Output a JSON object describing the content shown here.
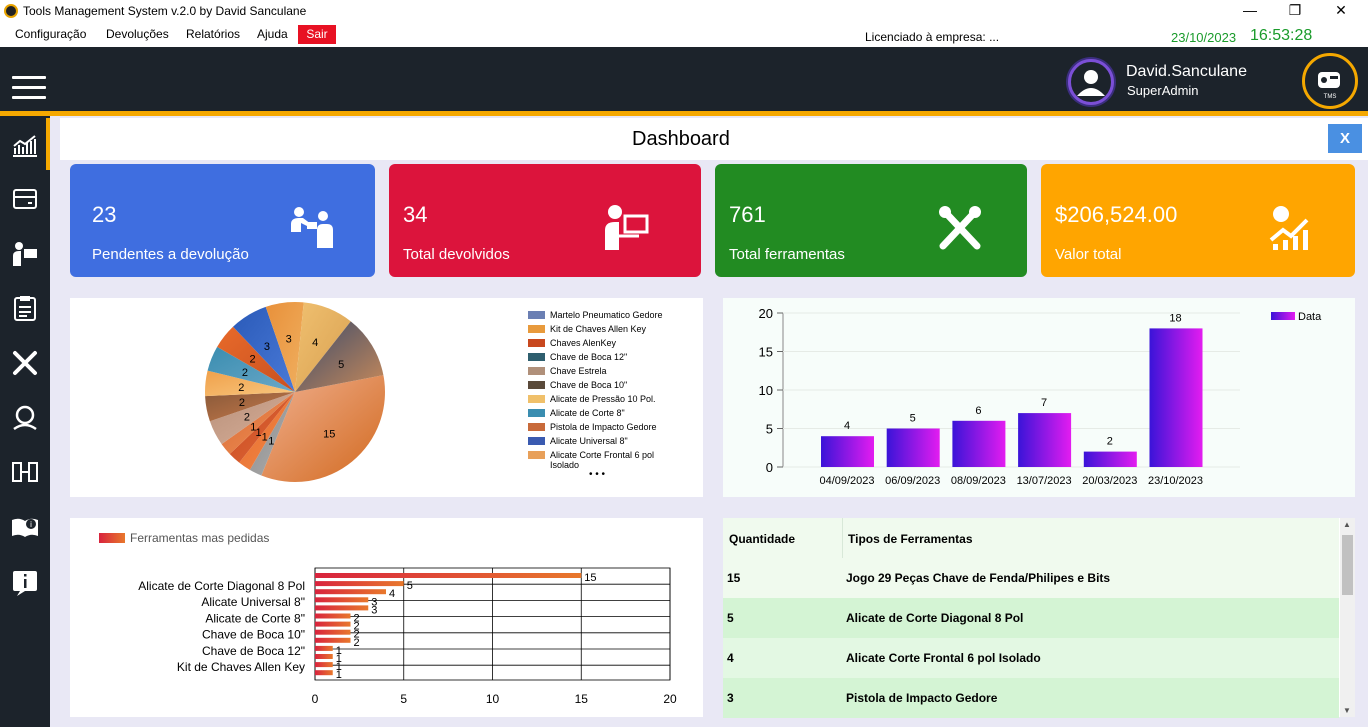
{
  "window": {
    "title": "Tools Management System v.2.0 by David Sanculane"
  },
  "menu": {
    "items": [
      "Configuração",
      "Devoluções",
      "Relatórios",
      "Ajuda"
    ],
    "exit": "Sair"
  },
  "status": {
    "license": "Licenciado à empresa: ...",
    "date": "23/10/2023",
    "time": "16:53:28"
  },
  "user": {
    "name": "David.Sanculane",
    "role": "SuperAdmin",
    "logo_text": "TMS"
  },
  "dashboard": {
    "title": "Dashboard",
    "close": "X"
  },
  "cards": [
    {
      "value": "23",
      "label": "Pendentes a devolução",
      "color": "#3f6ee0",
      "icon": "people-handover-icon"
    },
    {
      "value": "34",
      "label": "Total devolvidos",
      "color": "#dc143c",
      "icon": "person-laptop-icon"
    },
    {
      "value": "761",
      "label": "Total ferramentas",
      "color": "#228b22",
      "icon": "tools-icon"
    },
    {
      "value": "$206,524.00",
      "label": "Valor total",
      "color": "#ffa500",
      "icon": "money-growth-icon"
    }
  ],
  "pie_legend": [
    "Martelo Pneumatico Gedore",
    "Kit de Chaves Allen Key",
    "Chaves AlenKey",
    "Chave de Boca 12\"",
    "Chave Estrela",
    "Chave de Boca 10\"",
    "Alicate de Pressão 10 Pol.",
    "Alicate de Corte 8\"",
    "Pistola de Impacto Gedore",
    "Alicate Universal 8\"",
    "Alicate Corte Frontal 6 pol Isolado"
  ],
  "pie_legend_more": "• • •",
  "bar_legend": "Ferramentas mas pedidas",
  "table": {
    "headers": [
      "Quantidade",
      "Tipos de Ferramentas"
    ],
    "rows": [
      [
        "15",
        "Jogo 29 Peças Chave de Fenda/Philipes e Bits"
      ],
      [
        "5",
        "Alicate de Corte  Diagonal 8 Pol"
      ],
      [
        "4",
        "Alicate Corte Frontal 6 pol Isolado"
      ],
      [
        "3",
        "Pistola de Impacto Gedore"
      ]
    ]
  },
  "chart_data": [
    {
      "type": "pie",
      "values": [
        15,
        1,
        1,
        1,
        1,
        2,
        2,
        2,
        2,
        2,
        3,
        3,
        4,
        5
      ],
      "labels": [
        "15",
        "1",
        "1",
        "1",
        "1",
        "2",
        "2",
        "2",
        "2",
        "2",
        "3",
        "3",
        "4",
        "5"
      ]
    },
    {
      "type": "bar",
      "categories": [
        "04/09/2023",
        "06/09/2023",
        "08/09/2023",
        "13/07/2023",
        "20/03/2023",
        "23/10/2023"
      ],
      "series": [
        {
          "name": "Data",
          "values": [
            4,
            5,
            6,
            7,
            2,
            18
          ]
        }
      ],
      "ylim": [
        0,
        20
      ],
      "yticks": [
        0,
        5,
        10,
        15,
        20
      ],
      "legend": "top-right"
    },
    {
      "type": "bar",
      "orientation": "horizontal",
      "categories": [
        "Alicate de Corte  Diagonal 8 Pol",
        "Alicate Universal 8\"",
        "Alicate de Corte 8\"",
        "Chave de Boca 10\"",
        "Chave de Boca 12\"",
        "Kit de Chaves Allen Key"
      ],
      "values": [
        15,
        5,
        4,
        3,
        3,
        2,
        2,
        2,
        2,
        1,
        1,
        1,
        1
      ],
      "series_name": "Ferramentas mas pedidas",
      "xlim": [
        0,
        20
      ],
      "xticks": [
        0,
        5,
        10,
        15,
        20
      ],
      "legend": "top-left"
    }
  ]
}
